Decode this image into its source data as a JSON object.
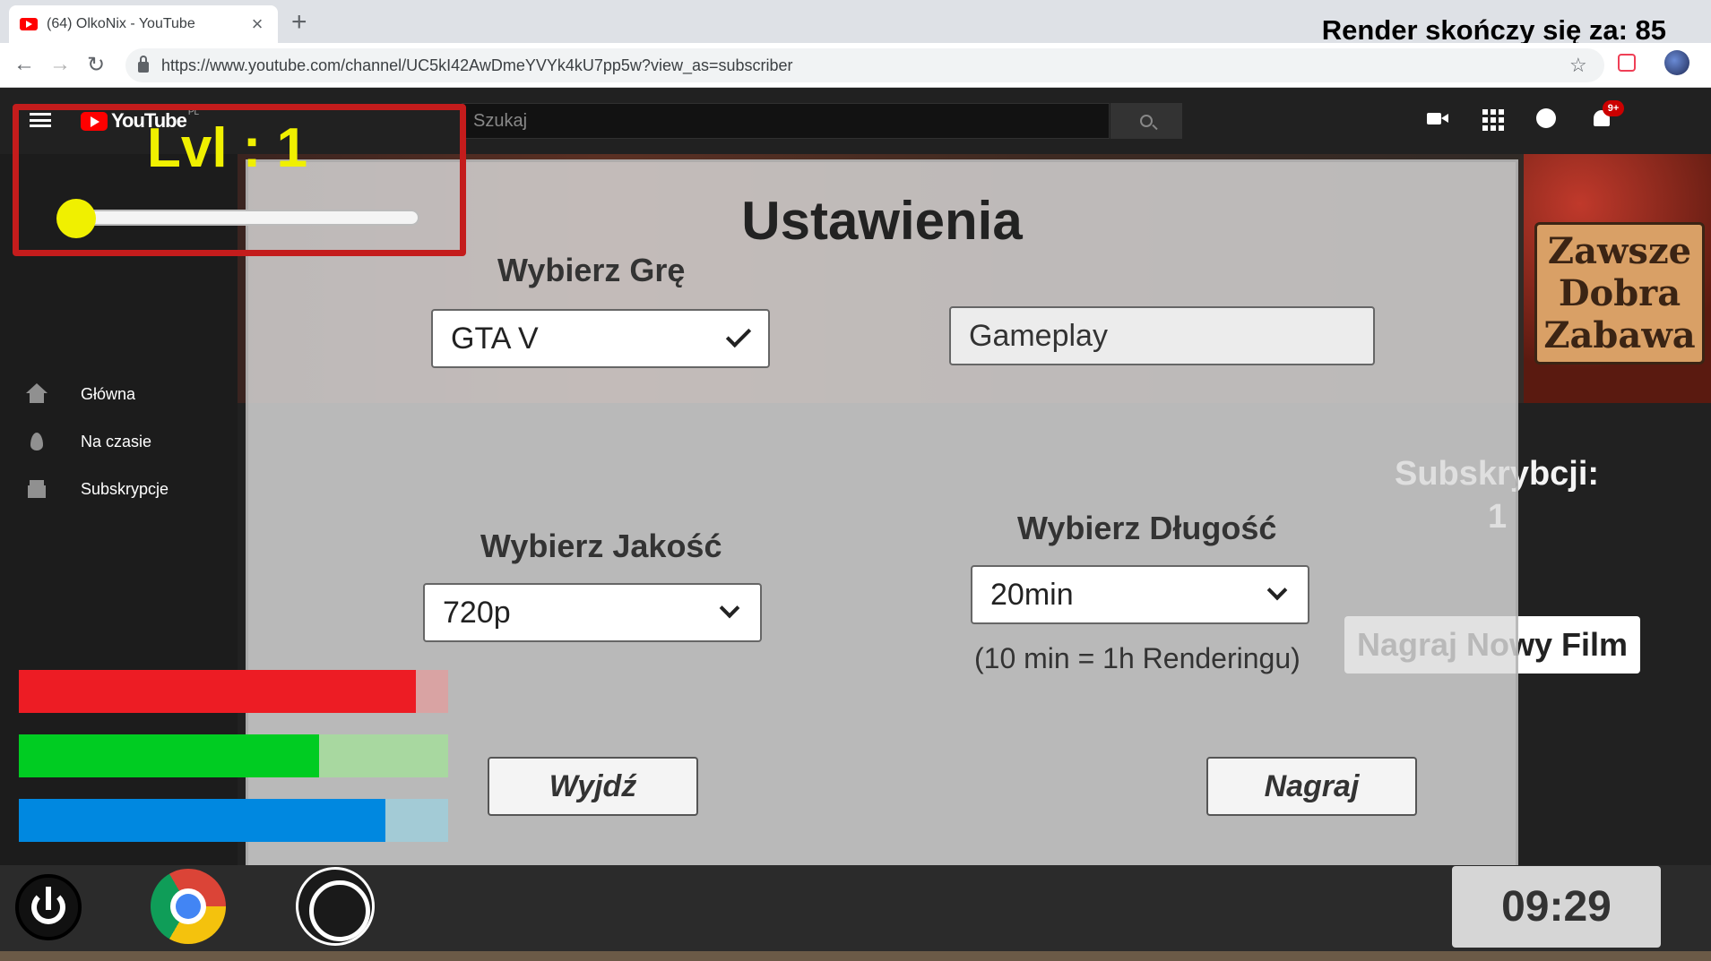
{
  "browser": {
    "tab_title": "(64) OlkoNix - YouTube",
    "tab_close": "×",
    "new_tab": "+",
    "url": "https://www.youtube.com/channel/UC5kI42AwDmeYVYk4kU7pp5w?view_as=subscriber"
  },
  "overlay": {
    "render_timer": "Render skończy się za: 85"
  },
  "youtube": {
    "logo_text": "YouTube",
    "logo_region": "PL",
    "search_placeholder": "Szukaj",
    "notification_badge": "9+",
    "sidebar": [
      {
        "label": "Główna",
        "icon": "home-icon"
      },
      {
        "label": "Na czasie",
        "icon": "fire-icon"
      },
      {
        "label": "Subskrypcje",
        "icon": "subscriptions-icon"
      }
    ],
    "banner_sign": "Zawsze Dobra Zabawa",
    "subscribers_label": "Subskrybcji:",
    "subscribers_value": "1",
    "new_film_button": "Nagraj Nowy Film"
  },
  "settings": {
    "title": "Ustawienia",
    "game_label": "Wybierz Grę",
    "game_value": "GTA V",
    "category_value": "Gameplay",
    "quality_label": "Wybierz Jakość",
    "quality_value": "720p",
    "length_label": "Wybierz Długość",
    "length_value": "20min",
    "length_note": "(10 min = 1h Renderingu)",
    "exit_button": "Wyjdź",
    "record_button": "Nagraj"
  },
  "hud": {
    "level_text": "Lvl : 1",
    "level_progress": 0,
    "stats": [
      {
        "name": "red",
        "color": "#ed1c24",
        "track": "#d9a3a3",
        "fill": 0.924
      },
      {
        "name": "green",
        "color": "#00cc22",
        "track": "#a8d8a0",
        "fill": 0.699
      },
      {
        "name": "blue",
        "color": "#0088e0",
        "track": "#a3cbd6",
        "fill": 0.853
      }
    ]
  },
  "taskbar": {
    "clock": "09:29"
  },
  "colors": {
    "accent_yellow": "#f0f000",
    "frame_red": "#c41c1c",
    "page_dark": "#212121"
  }
}
